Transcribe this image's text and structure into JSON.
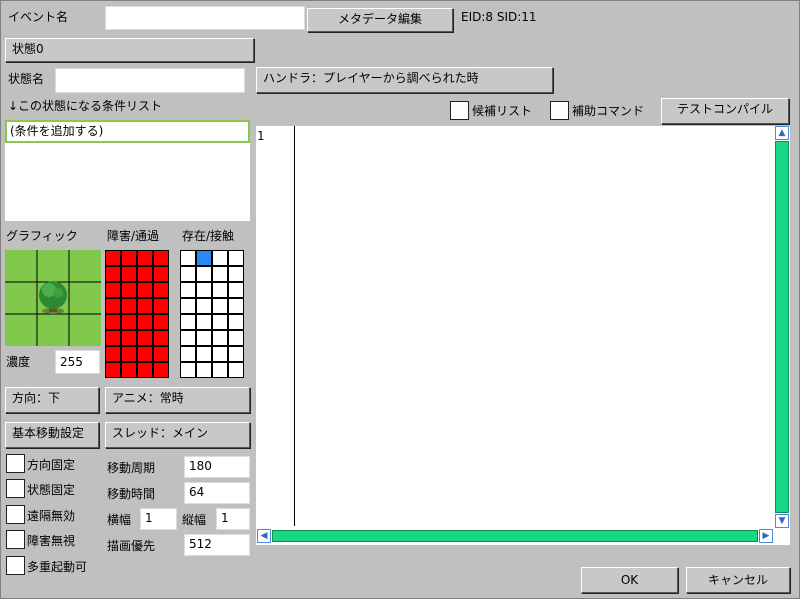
{
  "event": {
    "name_label": "イベント名",
    "name_value": "",
    "metadata_button": "メタデータ編集",
    "ids": "EID:8 SID:11"
  },
  "state": {
    "tab_label": "状態0",
    "name_label": "状態名",
    "name_value": "",
    "handler_button": "ハンドラ：プレイヤーから調べられた時",
    "condition_header": "↓この状態になる条件リスト",
    "conditions": [
      "(条件を追加する)"
    ]
  },
  "editor": {
    "candidate_list_label": "候補リスト",
    "aux_command_label": "補助コマンド",
    "test_compile_button": "テストコンパイル",
    "line_numbers": [
      "1"
    ],
    "scroll_up_glyph": "▲",
    "scroll_down_glyph": "▼",
    "scroll_left_glyph": "◀",
    "scroll_right_glyph": "▶"
  },
  "graphics": {
    "graphic_label": "グラフィック",
    "obstacle_label": "障害/通過",
    "presence_label": "存在/接触",
    "density_label": "濃度",
    "density_value": "255",
    "obstacle_color": "#ff0000",
    "presence_marked_cell": [
      0,
      1
    ],
    "presence_mark_color": "#2a8af5",
    "grid_rows": 8,
    "grid_cols": 4
  },
  "movement": {
    "direction_button": "方向：下",
    "animation_button": "アニメ：常時",
    "basic_move_button": "基本移動設定",
    "thread_button": "スレッド：メイン",
    "checkboxes": [
      "方向固定",
      "状態固定",
      "遠隔無効",
      "障害無視",
      "多重起動可"
    ],
    "move_period_label": "移動周期",
    "move_period_value": "180",
    "move_time_label": "移動時間",
    "move_time_value": "64",
    "width_label": "横幅",
    "width_value": "1",
    "height_label": "縦幅",
    "height_value": "1",
    "draw_priority_label": "描画優先",
    "draw_priority_value": "512"
  },
  "dialog": {
    "ok_button": "OK",
    "cancel_button": "キャンセル"
  }
}
